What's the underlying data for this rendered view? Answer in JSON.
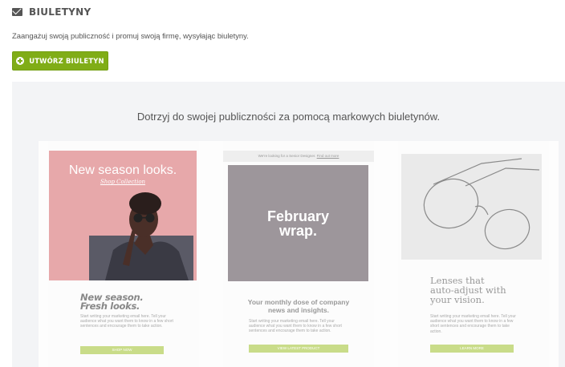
{
  "header": {
    "title": "BIULETYNY",
    "icon": "envelope-icon"
  },
  "description": "Zaangażuj swoją publiczność i promuj swoją firmę, wysyłając biuletyny.",
  "create_button": {
    "label": "UTWÓRZ BIULETYN",
    "icon": "plus-circle-icon",
    "color": "#80ad17"
  },
  "promo": {
    "title": "Dotrzyj do swojej publiczności za pomocą markowych biuletynów.",
    "cards": [
      {
        "hero_headline": "New season looks.",
        "hero_link": "Shop Collection",
        "title_line1": "New season.",
        "title_line2": "Fresh looks.",
        "body": "Start writing your marketing email here. Tell your audience what you want them to know in a few short sentences and encourage them to take action.",
        "button": "SHOP NOW"
      },
      {
        "bar_text": "We're looking for a Senior Designer.",
        "bar_link": "Find out more",
        "hero_line1": "February",
        "hero_line2": "wrap.",
        "title": "Your monthly dose of company news and insights.",
        "body": "Start writing your marketing email here. Tell your audience what you want them to know in a few short sentences and encourage them to take action.",
        "button": "VIEW LATEST PRODUCT"
      },
      {
        "title_line1": "Lenses that",
        "title_line2": "auto-adjust with",
        "title_line3": "your vision.",
        "body": "Start writing your marketing email here. Tell your audience what you want them to know in a few short sentences and encourage them to take action.",
        "button": "LEARN MORE"
      }
    ]
  }
}
